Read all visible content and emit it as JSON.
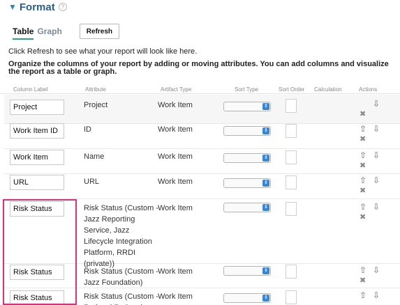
{
  "section": {
    "title": "Format",
    "arrow_icon": "triangle-down-icon",
    "help_glyph": "?"
  },
  "tabs": [
    {
      "label": "Table",
      "active": true
    },
    {
      "label": "Graph",
      "active": false
    }
  ],
  "refresh_label": "Refresh",
  "info_text": "Click Refresh to see what your report will look like here.",
  "instructions": "Organize the columns of your report by adding or moving attributes. You can add columns and visualize the report as a table or graph.",
  "columns": [
    "Column Label",
    "Attribute",
    "Artifact Type",
    "Sort Type",
    "Sort Order",
    "Calculation",
    "Actions"
  ],
  "rows": [
    {
      "label": "Project",
      "attribute": "Project",
      "artifact_type": "Work Item"
    },
    {
      "label": "Work Item ID",
      "attribute": "ID",
      "artifact_type": "Work Item"
    },
    {
      "label": "Work Item",
      "attribute": "Name",
      "artifact_type": "Work Item"
    },
    {
      "label": "URL",
      "attribute": "URL",
      "artifact_type": "Work Item"
    },
    {
      "label": "Risk Status",
      "attribute": "Risk Status (Custom - Jazz Reporting Service, Jazz Lifecycle Integration Platform, RRDI (private))",
      "artifact_type": "Work Item"
    },
    {
      "label": "Risk Status",
      "attribute": "Risk Status (Custom - Jazz Foundation)",
      "artifact_type": "Work Item"
    },
    {
      "label": "Risk Status",
      "attribute": "Risk Status (Custom - Rational Rational",
      "artifact_type": "Work Item"
    }
  ],
  "icons": {
    "up": "up-arrow-icon",
    "down": "down-arrow-icon",
    "delete": "delete-x-icon",
    "select": "select-chevron-icon"
  },
  "colors": {
    "accent": "#2a9d8f",
    "highlight": "#d6317a",
    "select_chevron": "#3a86d6"
  }
}
